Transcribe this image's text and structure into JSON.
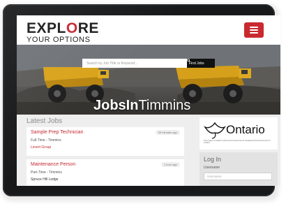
{
  "header": {
    "logo_top_left": "EXPL",
    "logo_top_o": "O",
    "logo_top_right": "RE",
    "logo_bottom": "YOUR OPTIONS",
    "menu_icon": "hamburger-menu-icon"
  },
  "hero": {
    "search_placeholder": "Search by Job Title or Keyword...",
    "find_label": "Find Jobs",
    "find_icon": "search-icon",
    "brand_bold": "JobsIn",
    "brand_light": "Timmins"
  },
  "latest": {
    "heading": "Latest Jobs",
    "jobs": [
      {
        "title": "Sample Prep Technician",
        "meta": "Full-Time - Timmins",
        "company": "Levert Group",
        "time": "39 minutes ago"
      },
      {
        "title": "Maintenance Person",
        "meta": "Part-Time - Timmins",
        "company": "Spruce Hill Lodge",
        "time": "1 hour ago"
      }
    ]
  },
  "sidebar": {
    "ontario_name": "Ontario",
    "ontario_fine": "This project is funded in part by the Government of Canada and the Government of Ontario.",
    "login_title": "Log In",
    "username_label": "Username",
    "username_placeholder": "Username"
  },
  "colors": {
    "brand_red": "#c4272f",
    "device_frame": "#17181a",
    "content_bg": "#eeeeee"
  }
}
